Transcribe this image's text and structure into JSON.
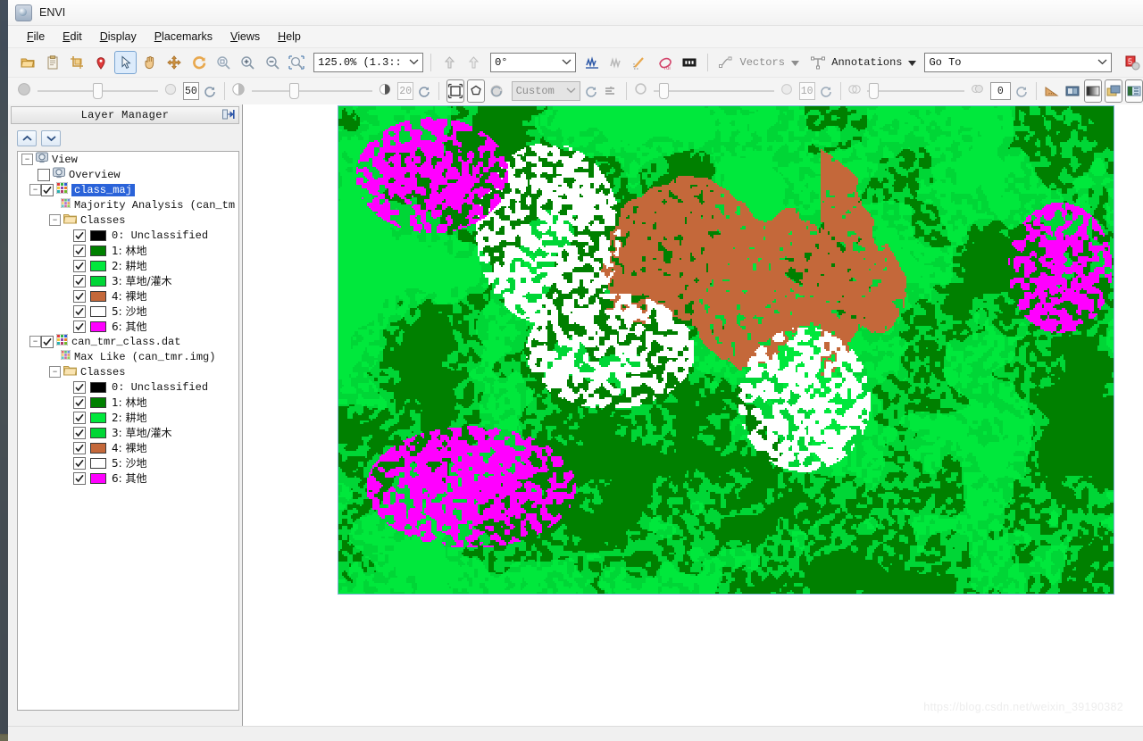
{
  "window": {
    "title": "ENVI",
    "app_icon": "envi-globe-icon"
  },
  "menubar": {
    "items": [
      {
        "label": "File",
        "mnemonic": "F"
      },
      {
        "label": "Edit",
        "mnemonic": "E"
      },
      {
        "label": "Display",
        "mnemonic": "D"
      },
      {
        "label": "Placemarks",
        "mnemonic": "P"
      },
      {
        "label": "Views",
        "mnemonic": "V"
      },
      {
        "label": "Help",
        "mnemonic": "H"
      }
    ]
  },
  "toolbar_main": {
    "buttons": [
      {
        "name": "open-file-icon",
        "title": "Open"
      },
      {
        "name": "paste-clipboard-icon",
        "title": "Paste"
      },
      {
        "name": "crop-icon",
        "title": "Crop"
      },
      {
        "name": "placemark-pin-icon",
        "title": "Placemark"
      },
      {
        "name": "select-cursor-icon",
        "title": "Select",
        "selected": true
      },
      {
        "name": "pan-hand-icon",
        "title": "Pan"
      },
      {
        "name": "fly-move-icon",
        "title": "Fly"
      },
      {
        "name": "rotate-icon",
        "title": "Rotate"
      },
      {
        "name": "zoom-fit-icon",
        "title": "Zoom to fit"
      },
      {
        "name": "zoom-in-icon",
        "title": "Zoom in"
      },
      {
        "name": "zoom-out-icon",
        "title": "Zoom out"
      },
      {
        "name": "zoom-selection-icon",
        "title": "Zoom to selection"
      }
    ],
    "zoom_value": "125.0% (1.3::",
    "rotation_value": "0°",
    "after_buttons": [
      {
        "name": "snapshot-up-icon",
        "title": "Previous"
      },
      {
        "name": "snapshot-down-icon",
        "title": "Next"
      }
    ],
    "tools": [
      {
        "name": "spectral-profile-icon",
        "title": "Spectral Profile"
      },
      {
        "name": "multi-profile-icon",
        "title": "Profiles"
      },
      {
        "name": "cursor-value-icon",
        "title": "Cursor Value"
      },
      {
        "name": "region-of-interest-icon",
        "title": "ROI Tool"
      },
      {
        "name": "data-values-icon",
        "title": "Data Values"
      }
    ],
    "vectors_label": "Vectors",
    "annotations_label": "Annotations",
    "goto_value": "Go To",
    "extra_button": {
      "name": "extension-icon",
      "title": "Extensions"
    }
  },
  "toolbar_display": {
    "brightness": {
      "name": "brightness",
      "value": "50"
    },
    "contrast": {
      "name": "contrast",
      "value": "20"
    },
    "sharpen": {
      "name": "sharpen",
      "value": "10"
    },
    "transparency": {
      "name": "transparency",
      "value": "0"
    },
    "stretch_value": "Custom",
    "buttons": [
      {
        "name": "square-stretch-icon",
        "title": "Square stretch"
      },
      {
        "name": "polygon-stretch-icon",
        "title": "Polygon stretch"
      },
      {
        "name": "refresh-stretch-icon",
        "title": "Recalculate stretch"
      },
      {
        "name": "reset-stretch-icon",
        "title": "Reset"
      },
      {
        "name": "histogram-stretch-icon",
        "title": "Histogram"
      },
      {
        "name": "measure-icon",
        "title": "Mensuration"
      },
      {
        "name": "portal-icon",
        "title": "Portal"
      },
      {
        "name": "grayscale-icon",
        "title": "Grayscale"
      },
      {
        "name": "blend-icon",
        "title": "Blend"
      },
      {
        "name": "flicker-icon",
        "title": "Flicker"
      }
    ]
  },
  "layer_manager": {
    "title": "Layer Manager",
    "pin_icon": "dock-pin-icon",
    "move_up": "move-layer-up-icon",
    "move_down": "move-layer-down-icon",
    "tree": {
      "root": {
        "label": "View",
        "icon": "view-icon",
        "expanded": true
      },
      "overview": {
        "label": "Overview",
        "icon": "view-icon",
        "checked": false
      },
      "layers": [
        {
          "label": "class_maj",
          "icon": "classification-icon",
          "checked": true,
          "selected": true,
          "child": {
            "label": "Majority Analysis (can_tm",
            "icon": "raster-icon"
          },
          "classes_label": "Classes",
          "classes": [
            {
              "index": "0:",
              "name": "Unclassified",
              "color": "#000000",
              "checked": true,
              "cjk": false
            },
            {
              "index": "1:",
              "name": "林地",
              "color": "#008000",
              "checked": true,
              "cjk": true
            },
            {
              "index": "2:",
              "name": "耕地",
              "color": "#00e83c",
              "checked": true,
              "cjk": true
            },
            {
              "index": "3:",
              "name": "草地/灌木",
              "color": "#00d636",
              "checked": true,
              "cjk": true
            },
            {
              "index": "4:",
              "name": "裸地",
              "color": "#c4683a",
              "checked": true,
              "cjk": true
            },
            {
              "index": "5:",
              "name": "沙地",
              "color": "#ffffff",
              "checked": true,
              "cjk": true
            },
            {
              "index": "6:",
              "name": "其他",
              "color": "#ff00ff",
              "checked": true,
              "cjk": true
            }
          ]
        },
        {
          "label": "can_tmr_class.dat",
          "icon": "classification-icon",
          "checked": true,
          "selected": false,
          "child": {
            "label": "Max Like (can_tmr.img)",
            "icon": "raster-icon"
          },
          "classes_label": "Classes",
          "classes": [
            {
              "index": "0:",
              "name": "Unclassified",
              "color": "#000000",
              "checked": true,
              "cjk": false
            },
            {
              "index": "1:",
              "name": "林地",
              "color": "#008000",
              "checked": true,
              "cjk": true
            },
            {
              "index": "2:",
              "name": "耕地",
              "color": "#00e83c",
              "checked": true,
              "cjk": true
            },
            {
              "index": "3:",
              "name": "草地/灌木",
              "color": "#00d636",
              "checked": true,
              "cjk": true
            },
            {
              "index": "4:",
              "name": "裸地",
              "color": "#c4683a",
              "checked": true,
              "cjk": true
            },
            {
              "index": "5:",
              "name": "沙地",
              "color": "#ffffff",
              "checked": true,
              "cjk": true
            },
            {
              "index": "6:",
              "name": "其他",
              "color": "#ff00ff",
              "checked": true,
              "cjk": true
            }
          ]
        }
      ]
    }
  },
  "view": {
    "raster_name": "classification-raster",
    "border_color": "#7fb3d5",
    "palette": [
      "#000000",
      "#008000",
      "#00e83c",
      "#00d636",
      "#c4683a",
      "#ffffff",
      "#ff00ff"
    ],
    "watermark": "https://blog.csdn.net/weixin_39190382"
  }
}
